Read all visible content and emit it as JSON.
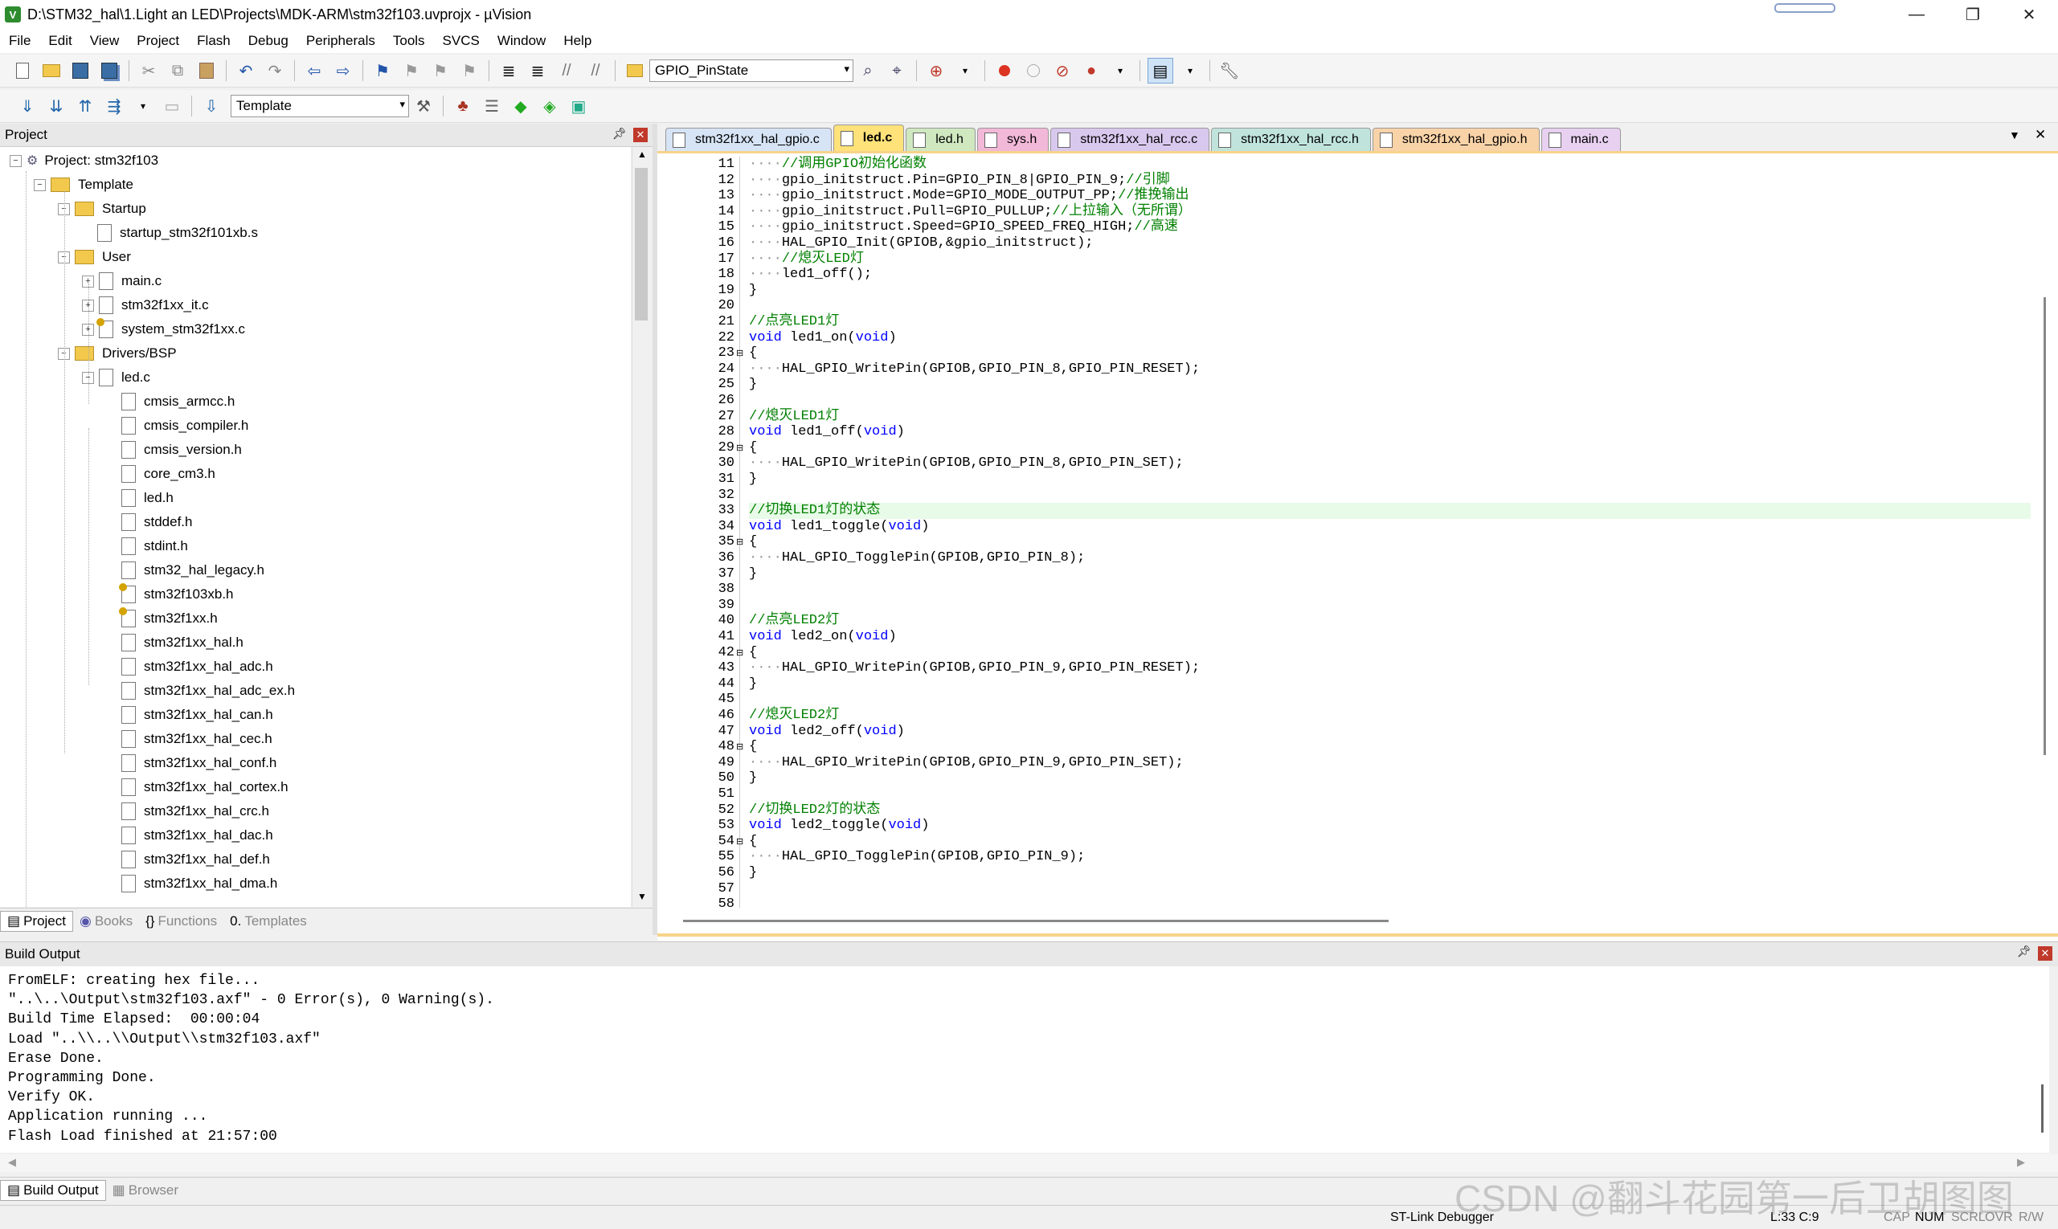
{
  "window": {
    "title": "D:\\STM32_hal\\1.Light an LED\\Projects\\MDK-ARM\\stm32f103.uvprojx - µVision",
    "minimize": "—",
    "maximize": "❐",
    "close": "✕"
  },
  "menu": [
    "File",
    "Edit",
    "View",
    "Project",
    "Flash",
    "Debug",
    "Peripherals",
    "Tools",
    "SVCS",
    "Window",
    "Help"
  ],
  "toolbar1": {
    "find_combo": "GPIO_PinState"
  },
  "toolbar2": {
    "target_combo": "Template"
  },
  "project_panel": {
    "title": "Project",
    "tree": [
      {
        "label": "Project: stm32f103",
        "depth": 0,
        "type": "root",
        "exp": "−"
      },
      {
        "label": "Template",
        "depth": 1,
        "type": "target",
        "exp": "−"
      },
      {
        "label": "Startup",
        "depth": 2,
        "type": "folder",
        "exp": "−"
      },
      {
        "label": "startup_stm32f101xb.s",
        "depth": 3,
        "type": "file",
        "exp": ""
      },
      {
        "label": "User",
        "depth": 2,
        "type": "folder",
        "exp": "−"
      },
      {
        "label": "main.c",
        "depth": 3,
        "type": "file",
        "exp": "+"
      },
      {
        "label": "stm32f1xx_it.c",
        "depth": 3,
        "type": "file",
        "exp": "+"
      },
      {
        "label": "system_stm32f1xx.c",
        "depth": 3,
        "type": "keyfile",
        "exp": "+"
      },
      {
        "label": "Drivers/BSP",
        "depth": 2,
        "type": "folder",
        "exp": "−"
      },
      {
        "label": "led.c",
        "depth": 3,
        "type": "file",
        "exp": "−"
      },
      {
        "label": "cmsis_armcc.h",
        "depth": 4,
        "type": "file",
        "exp": ""
      },
      {
        "label": "cmsis_compiler.h",
        "depth": 4,
        "type": "file",
        "exp": ""
      },
      {
        "label": "cmsis_version.h",
        "depth": 4,
        "type": "file",
        "exp": ""
      },
      {
        "label": "core_cm3.h",
        "depth": 4,
        "type": "file",
        "exp": ""
      },
      {
        "label": "led.h",
        "depth": 4,
        "type": "file",
        "exp": ""
      },
      {
        "label": "stddef.h",
        "depth": 4,
        "type": "file",
        "exp": ""
      },
      {
        "label": "stdint.h",
        "depth": 4,
        "type": "file",
        "exp": ""
      },
      {
        "label": "stm32_hal_legacy.h",
        "depth": 4,
        "type": "file",
        "exp": ""
      },
      {
        "label": "stm32f103xb.h",
        "depth": 4,
        "type": "keyfile",
        "exp": ""
      },
      {
        "label": "stm32f1xx.h",
        "depth": 4,
        "type": "keyfile",
        "exp": ""
      },
      {
        "label": "stm32f1xx_hal.h",
        "depth": 4,
        "type": "file",
        "exp": ""
      },
      {
        "label": "stm32f1xx_hal_adc.h",
        "depth": 4,
        "type": "file",
        "exp": ""
      },
      {
        "label": "stm32f1xx_hal_adc_ex.h",
        "depth": 4,
        "type": "file",
        "exp": ""
      },
      {
        "label": "stm32f1xx_hal_can.h",
        "depth": 4,
        "type": "file",
        "exp": ""
      },
      {
        "label": "stm32f1xx_hal_cec.h",
        "depth": 4,
        "type": "file",
        "exp": ""
      },
      {
        "label": "stm32f1xx_hal_conf.h",
        "depth": 4,
        "type": "file",
        "exp": ""
      },
      {
        "label": "stm32f1xx_hal_cortex.h",
        "depth": 4,
        "type": "file",
        "exp": ""
      },
      {
        "label": "stm32f1xx_hal_crc.h",
        "depth": 4,
        "type": "file",
        "exp": ""
      },
      {
        "label": "stm32f1xx_hal_dac.h",
        "depth": 4,
        "type": "file",
        "exp": ""
      },
      {
        "label": "stm32f1xx_hal_def.h",
        "depth": 4,
        "type": "file",
        "exp": ""
      },
      {
        "label": "stm32f1xx_hal_dma.h",
        "depth": 4,
        "type": "file",
        "exp": ""
      }
    ],
    "tabs": [
      "Project",
      "Books",
      "Functions",
      "Templates"
    ]
  },
  "editor": {
    "tabs": [
      {
        "label": "stm32f1xx_hal_gpio.c",
        "color": "#d6e4f5",
        "active": false
      },
      {
        "label": "led.c",
        "color": "#ffe27a",
        "active": true
      },
      {
        "label": "led.h",
        "color": "#cfe8c0",
        "active": false
      },
      {
        "label": "sys.h",
        "color": "#f2b8d8",
        "active": false
      },
      {
        "label": "stm32f1xx_hal_rcc.c",
        "color": "#d9c8ee",
        "active": false
      },
      {
        "label": "stm32f1xx_hal_rcc.h",
        "color": "#c0e4dc",
        "active": false
      },
      {
        "label": "stm32f1xx_hal_gpio.h",
        "color": "#f9d3a8",
        "active": false
      },
      {
        "label": "main.c",
        "color": "#e8d0f0",
        "active": false
      }
    ],
    "highlight_line": 33,
    "lines": [
      {
        "n": "11",
        "f": "",
        "code": [
          [
            "dots",
            "····"
          ],
          [
            "cm",
            "//调用GPIO初始化函数"
          ]
        ]
      },
      {
        "n": "12",
        "f": "",
        "code": [
          [
            "dots",
            "····"
          ],
          [
            "t",
            "gpio_initstruct.Pin=GPIO_PIN_8|GPIO_PIN_9;"
          ],
          [
            "cm",
            "//引脚"
          ]
        ]
      },
      {
        "n": "13",
        "f": "",
        "code": [
          [
            "dots",
            "····"
          ],
          [
            "t",
            "gpio_initstruct.Mode=GPIO_MODE_OUTPUT_PP;"
          ],
          [
            "cm",
            "//推挽输出"
          ]
        ]
      },
      {
        "n": "14",
        "f": "",
        "code": [
          [
            "dots",
            "····"
          ],
          [
            "t",
            "gpio_initstruct.Pull=GPIO_PULLUP;"
          ],
          [
            "cm",
            "//上拉输入（无所谓）"
          ]
        ]
      },
      {
        "n": "15",
        "f": "",
        "code": [
          [
            "dots",
            "····"
          ],
          [
            "t",
            "gpio_initstruct.Speed=GPIO_SPEED_FREQ_HIGH;"
          ],
          [
            "cm",
            "//高速"
          ]
        ]
      },
      {
        "n": "16",
        "f": "",
        "code": [
          [
            "dots",
            "····"
          ],
          [
            "t",
            "HAL_GPIO_Init(GPIOB,&gpio_initstruct);"
          ]
        ]
      },
      {
        "n": "17",
        "f": "",
        "code": [
          [
            "dots",
            "····"
          ],
          [
            "cm",
            "//熄灭LED灯"
          ]
        ]
      },
      {
        "n": "18",
        "f": "",
        "code": [
          [
            "dots",
            "····"
          ],
          [
            "t",
            "led1_off();"
          ]
        ]
      },
      {
        "n": "19",
        "f": "",
        "code": [
          [
            "t",
            "}"
          ]
        ]
      },
      {
        "n": "20",
        "f": "",
        "code": []
      },
      {
        "n": "21",
        "f": "",
        "code": [
          [
            "cm",
            "//点亮LED1灯"
          ]
        ]
      },
      {
        "n": "22",
        "f": "",
        "code": [
          [
            "kw",
            "void"
          ],
          [
            "t",
            " led1_on("
          ],
          [
            "kw",
            "void"
          ],
          [
            "t",
            ")"
          ]
        ]
      },
      {
        "n": "23",
        "f": "⊟",
        "code": [
          [
            "t",
            "{"
          ]
        ]
      },
      {
        "n": "24",
        "f": "",
        "code": [
          [
            "dots",
            "····"
          ],
          [
            "t",
            "HAL_GPIO_WritePin(GPIOB,GPIO_PIN_8,GPIO_PIN_RESET);"
          ]
        ]
      },
      {
        "n": "25",
        "f": "",
        "code": [
          [
            "t",
            "}"
          ]
        ]
      },
      {
        "n": "26",
        "f": "",
        "code": []
      },
      {
        "n": "27",
        "f": "",
        "code": [
          [
            "cm",
            "//熄灭LED1灯"
          ]
        ]
      },
      {
        "n": "28",
        "f": "",
        "code": [
          [
            "kw",
            "void"
          ],
          [
            "t",
            " led1_off("
          ],
          [
            "kw",
            "void"
          ],
          [
            "t",
            ")"
          ]
        ]
      },
      {
        "n": "29",
        "f": "⊟",
        "code": [
          [
            "t",
            "{"
          ]
        ]
      },
      {
        "n": "30",
        "f": "",
        "code": [
          [
            "dots",
            "····"
          ],
          [
            "t",
            "HAL_GPIO_WritePin(GPIOB,GPIO_PIN_8,GPIO_PIN_SET);"
          ]
        ]
      },
      {
        "n": "31",
        "f": "",
        "code": [
          [
            "t",
            "}"
          ]
        ]
      },
      {
        "n": "32",
        "f": "",
        "code": []
      },
      {
        "n": "33",
        "f": "",
        "code": [
          [
            "cm",
            "//切换LED1灯的状态"
          ]
        ]
      },
      {
        "n": "34",
        "f": "",
        "code": [
          [
            "kw",
            "void"
          ],
          [
            "t",
            " led1_toggle("
          ],
          [
            "kw",
            "void"
          ],
          [
            "t",
            ")"
          ]
        ]
      },
      {
        "n": "35",
        "f": "⊟",
        "code": [
          [
            "t",
            "{"
          ]
        ]
      },
      {
        "n": "36",
        "f": "",
        "code": [
          [
            "dots",
            "····"
          ],
          [
            "t",
            "HAL_GPIO_TogglePin(GPIOB,GPIO_PIN_8);"
          ]
        ]
      },
      {
        "n": "37",
        "f": "",
        "code": [
          [
            "t",
            "}"
          ]
        ]
      },
      {
        "n": "38",
        "f": "",
        "code": []
      },
      {
        "n": "39",
        "f": "",
        "code": []
      },
      {
        "n": "40",
        "f": "",
        "code": [
          [
            "cm",
            "//点亮LED2灯"
          ]
        ]
      },
      {
        "n": "41",
        "f": "",
        "code": [
          [
            "kw",
            "void"
          ],
          [
            "t",
            " led2_on("
          ],
          [
            "kw",
            "void"
          ],
          [
            "t",
            ")"
          ]
        ]
      },
      {
        "n": "42",
        "f": "⊟",
        "code": [
          [
            "t",
            "{"
          ]
        ]
      },
      {
        "n": "43",
        "f": "",
        "code": [
          [
            "dots",
            "····"
          ],
          [
            "t",
            "HAL_GPIO_WritePin(GPIOB,GPIO_PIN_9,GPIO_PIN_RESET);"
          ]
        ]
      },
      {
        "n": "44",
        "f": "",
        "code": [
          [
            "t",
            "}"
          ]
        ]
      },
      {
        "n": "45",
        "f": "",
        "code": []
      },
      {
        "n": "46",
        "f": "",
        "code": [
          [
            "cm",
            "//熄灭LED2灯"
          ]
        ]
      },
      {
        "n": "47",
        "f": "",
        "code": [
          [
            "kw",
            "void"
          ],
          [
            "t",
            " led2_off("
          ],
          [
            "kw",
            "void"
          ],
          [
            "t",
            ")"
          ]
        ]
      },
      {
        "n": "48",
        "f": "⊟",
        "code": [
          [
            "t",
            "{"
          ]
        ]
      },
      {
        "n": "49",
        "f": "",
        "code": [
          [
            "dots",
            "····"
          ],
          [
            "t",
            "HAL_GPIO_WritePin(GPIOB,GPIO_PIN_9,GPIO_PIN_SET);"
          ]
        ]
      },
      {
        "n": "50",
        "f": "",
        "code": [
          [
            "t",
            "}"
          ]
        ]
      },
      {
        "n": "51",
        "f": "",
        "code": []
      },
      {
        "n": "52",
        "f": "",
        "code": [
          [
            "cm",
            "//切换LED2灯的状态"
          ]
        ]
      },
      {
        "n": "53",
        "f": "",
        "code": [
          [
            "kw",
            "void"
          ],
          [
            "t",
            " led2_toggle("
          ],
          [
            "kw",
            "void"
          ],
          [
            "t",
            ")"
          ]
        ]
      },
      {
        "n": "54",
        "f": "⊟",
        "code": [
          [
            "t",
            "{"
          ]
        ]
      },
      {
        "n": "55",
        "f": "",
        "code": [
          [
            "dots",
            "····"
          ],
          [
            "t",
            "HAL_GPIO_TogglePin(GPIOB,GPIO_PIN_9);"
          ]
        ]
      },
      {
        "n": "56",
        "f": "",
        "code": [
          [
            "t",
            "}"
          ]
        ]
      },
      {
        "n": "57",
        "f": "",
        "code": []
      },
      {
        "n": "58",
        "f": "",
        "code": []
      }
    ]
  },
  "build_output": {
    "title": "Build Output",
    "lines": [
      "FromELF: creating hex file...",
      "\"..\\..\\Output\\stm32f103.axf\" - 0 Error(s), 0 Warning(s).",
      "Build Time Elapsed:  00:00:04",
      "Load \"..\\\\..\\\\Output\\\\stm32f103.axf\"",
      "Erase Done.",
      "Programming Done.",
      "Verify OK.",
      "Application running ...",
      "Flash Load finished at 21:57:00"
    ],
    "tabs": [
      "Build Output",
      "Browser"
    ]
  },
  "status": {
    "debugger": "ST-Link Debugger",
    "position": "L:33 C:9",
    "indicators": [
      "CAP",
      "NUM",
      "SCRL",
      "OVR",
      "R/W"
    ],
    "watermark": "CSDN @翻斗花园第一后卫胡图图"
  },
  "colors": {
    "keyword": "#0000ff",
    "comment": "#008000",
    "current_line": "#e8fae8",
    "active_tab": "#ffe27a"
  }
}
